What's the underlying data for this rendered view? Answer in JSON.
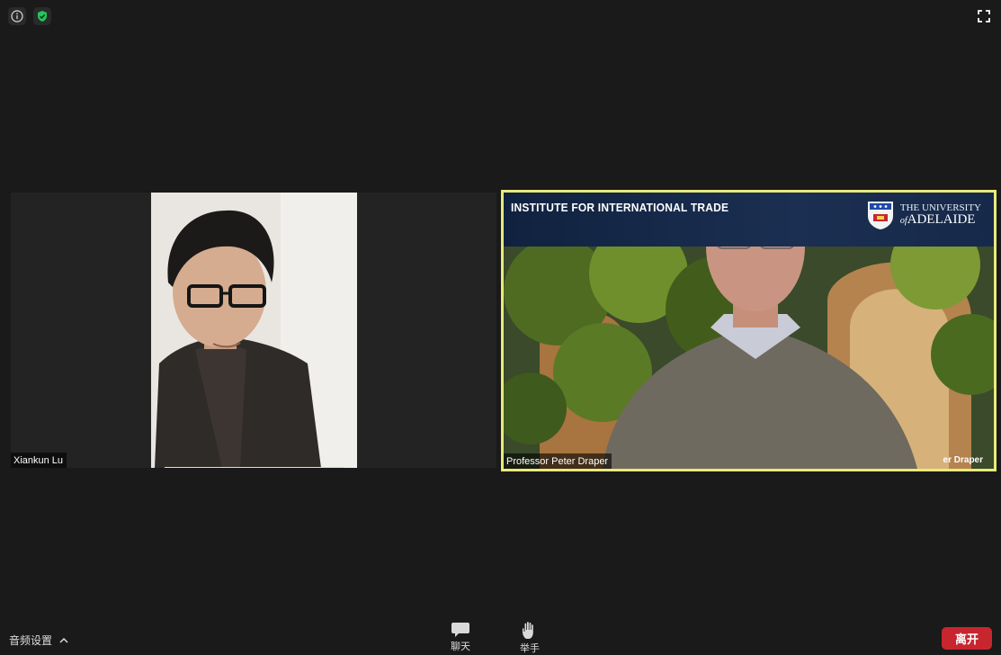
{
  "participants": [
    {
      "name": "Xiankun Lu"
    },
    {
      "name": "Professor Peter Draper"
    }
  ],
  "right_video": {
    "banner_title": "INSTITUTE FOR INTERNATIONAL TRADE",
    "logo_line1": "THE UNIVERSITY",
    "logo_of": "of",
    "logo_line2": "ADELAIDE",
    "bottom_caption": "er Draper"
  },
  "toolbar": {
    "audio_settings_label": "音频设置",
    "chat_label": "聊天",
    "raise_hand_label": "举手",
    "leave_label": "离开"
  },
  "colors": {
    "active_speaker_border": "#e8ea7c",
    "leave_button": "#c8262f",
    "shield_green": "#22c55e"
  },
  "icons": {
    "top_left": [
      "info-icon",
      "shield-check-icon"
    ],
    "top_right": "fullscreen-icon",
    "chat": "chat-bubble-icon",
    "raise_hand": "hand-icon",
    "audio_menu": "chevron-up-icon"
  }
}
